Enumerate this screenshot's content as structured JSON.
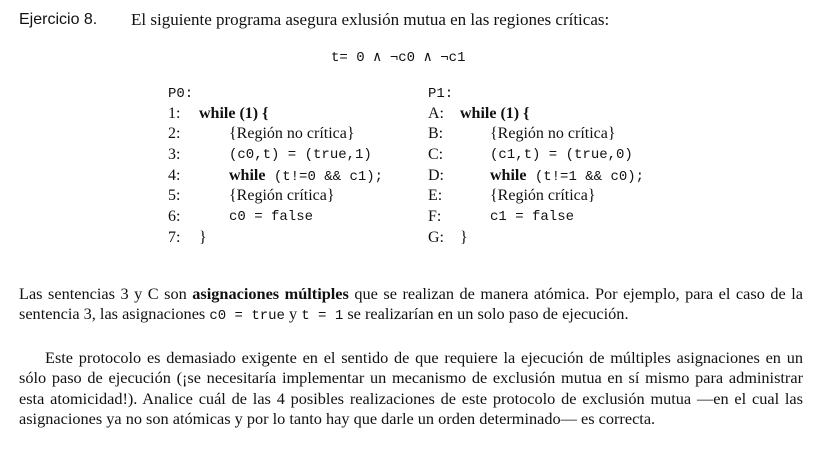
{
  "header": {
    "label": "Ejercicio 8.",
    "statement": "El siguiente programa asegura exlusión mutua en las regiones críticas:"
  },
  "formula": "t= 0 ∧ ¬c0 ∧ ¬c1",
  "p0": {
    "title": "P0:",
    "lines": [
      {
        "num": "1:",
        "kw": "while",
        "rest": " (1) {"
      },
      {
        "num": "2:",
        "text": "{Región no crítica}"
      },
      {
        "num": "3:",
        "code": "(c0,t) = (true,1)"
      },
      {
        "num": "4:",
        "kw": "while",
        "code": " (t!=0 && c1);"
      },
      {
        "num": "5:",
        "text": "{Región crítica}"
      },
      {
        "num": "6:",
        "code": "c0 = false"
      },
      {
        "num": "7:",
        "text": "}"
      }
    ]
  },
  "p1": {
    "title": "P1:",
    "lines": [
      {
        "num": "A:",
        "kw": "while",
        "rest": " (1) {"
      },
      {
        "num": "B:",
        "text": "{Región no crítica}"
      },
      {
        "num": "C:",
        "code": "(c1,t) = (true,0)"
      },
      {
        "num": "D:",
        "kw": "while",
        "code": " (t!=1 && c0);"
      },
      {
        "num": "E:",
        "text": "{Región crítica}"
      },
      {
        "num": "F:",
        "code": "c1 = false"
      },
      {
        "num": "G:",
        "text": "}"
      }
    ]
  },
  "paragraph1": {
    "t1": "Las sentencias 3 y C son ",
    "bold": "asignaciones múltiples",
    "t2": " que se realizan de manera atómica. Por ejemplo, para el caso de la sentencia 3, las asignaciones ",
    "code1": "c0 = true",
    "t3": " y ",
    "code2": "t = 1",
    "t4": " se realizarían en un solo paso de ejecución."
  },
  "paragraph2": "Este protocolo es demasiado exigente en el sentido de que requiere la ejecución de múltiples asignaciones en un sólo paso de ejecución (¡se necesitaría implementar un mecanismo de exclusión mutua en sí mismo para administrar esta atomicidad!). Analice cuál de las 4 posibles realizaciones de este protocolo de exclusión mutua —en el cual las asignaciones ya no son atómicas y por lo tanto hay que darle un orden determinado— es correcta."
}
